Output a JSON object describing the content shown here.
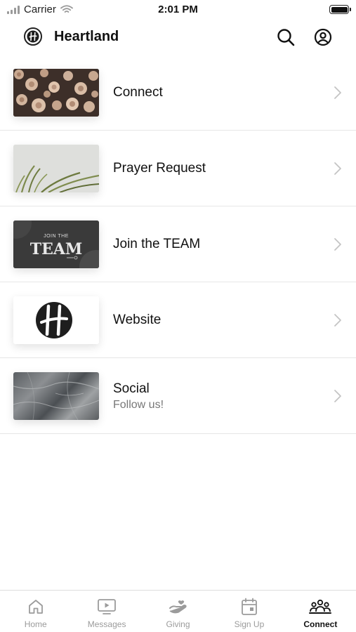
{
  "status_bar": {
    "carrier": "Carrier",
    "time": "2:01 PM"
  },
  "header": {
    "title": "Heartland",
    "icons": [
      "heartland-logo-icon",
      "search-icon",
      "account-icon"
    ]
  },
  "list": {
    "items": [
      {
        "title": "Connect",
        "subtitle": "",
        "thumbnail": "wood-logs-image"
      },
      {
        "title": "Prayer Request",
        "subtitle": "",
        "thumbnail": "plant-leaves-image"
      },
      {
        "title": "Join the TEAM",
        "subtitle": "",
        "thumbnail": "join-the-team-graphic",
        "thumbnail_text": {
          "small": "JOIN THE",
          "big": "TEAM"
        }
      },
      {
        "title": "Website",
        "subtitle": "",
        "thumbnail": "heartland-logo-image"
      },
      {
        "title": "Social",
        "subtitle": "Follow us!",
        "thumbnail": "marble-texture-image"
      }
    ]
  },
  "tabbar": {
    "active": "Connect",
    "tabs": [
      {
        "label": "Home",
        "icon": "home-icon"
      },
      {
        "label": "Messages",
        "icon": "tv-play-icon"
      },
      {
        "label": "Giving",
        "icon": "giving-hand-icon"
      },
      {
        "label": "Sign Up",
        "icon": "calendar-icon"
      },
      {
        "label": "Connect",
        "icon": "people-icon"
      }
    ]
  },
  "colors": {
    "text": "#111111",
    "muted": "#777777",
    "inactive_tab": "#9b9b9b",
    "divider": "#e6e6e6"
  }
}
